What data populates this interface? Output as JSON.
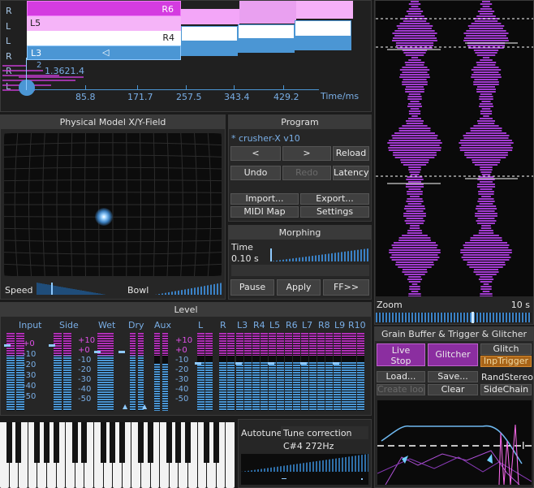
{
  "grain_view": {
    "rows_left": [
      "R",
      "L",
      "L",
      "R",
      "R",
      "L"
    ],
    "bars": [
      "R6",
      "L5",
      "R4",
      "L3"
    ],
    "marker": "1.3621.4",
    "ticks": [
      "85.8",
      "171.7",
      "257.5",
      "343.4",
      "429.2"
    ],
    "unit": "Time/ms"
  },
  "xy_field": {
    "title": "Physical Model X/Y-Field",
    "speed_label": "Speed",
    "bowl_label": "Bowl"
  },
  "program": {
    "title": "Program",
    "preset": "* crusher-X v10",
    "prev": "<",
    "next": ">",
    "reload": "Reload",
    "undo": "Undo",
    "redo": "Redo",
    "latency": "Latency",
    "import": "Import...",
    "export": "Export...",
    "midi_map": "MIDI Map",
    "settings": "Settings"
  },
  "morphing": {
    "title": "Morphing",
    "time_label": "Time",
    "time_value": "0.10 s",
    "pause": "Pause",
    "apply": "Apply",
    "ff": "FF>>"
  },
  "scope": {
    "zoom_label": "Zoom",
    "zoom_value": "10 s"
  },
  "level": {
    "title": "Level",
    "channels": [
      "Input",
      "Side",
      "Wet",
      "Dry",
      "Aux",
      "L",
      "R",
      "L3",
      "R4",
      "L5",
      "R6",
      "L7",
      "R8",
      "L9",
      "R10"
    ],
    "scale_a": [
      "+0",
      "-10",
      "-20",
      "-30",
      "-40",
      "-50"
    ],
    "scale_b": [
      "+10",
      "+0",
      "-10",
      "-20",
      "-30",
      "-40",
      "-50"
    ],
    "scale_c": [
      "+10",
      "+0",
      "-10",
      "-20",
      "-30",
      "-40",
      "-50"
    ],
    "levels": [
      0.88,
      0.88,
      0.78,
      0.78,
      0.6,
      0.62,
      0.62,
      0.62,
      0.62,
      0.62,
      0.62,
      0.62,
      0.62,
      0.62,
      0.62
    ]
  },
  "grain_buffer": {
    "title": "Grain Buffer & Trigger & Glitcher",
    "live_stop": [
      "Live",
      "Stop"
    ],
    "glitcher": "Glitcher",
    "glitch": "Glitch",
    "inp_trigger": "InpTrigger",
    "load": "Load...",
    "save": "Save...",
    "rand_stereo": "RandStereo",
    "create_loop": "Create loop",
    "clear": "Clear",
    "sidechain": "SideChain"
  },
  "autotune": {
    "label": "Autotune",
    "mode": "Tune correction",
    "note": "C#4 272Hz"
  },
  "colors": {
    "accent": "#4b96d4",
    "magenta": "#c43ad0",
    "panel": "#262626",
    "active": "#8b2ea0"
  }
}
